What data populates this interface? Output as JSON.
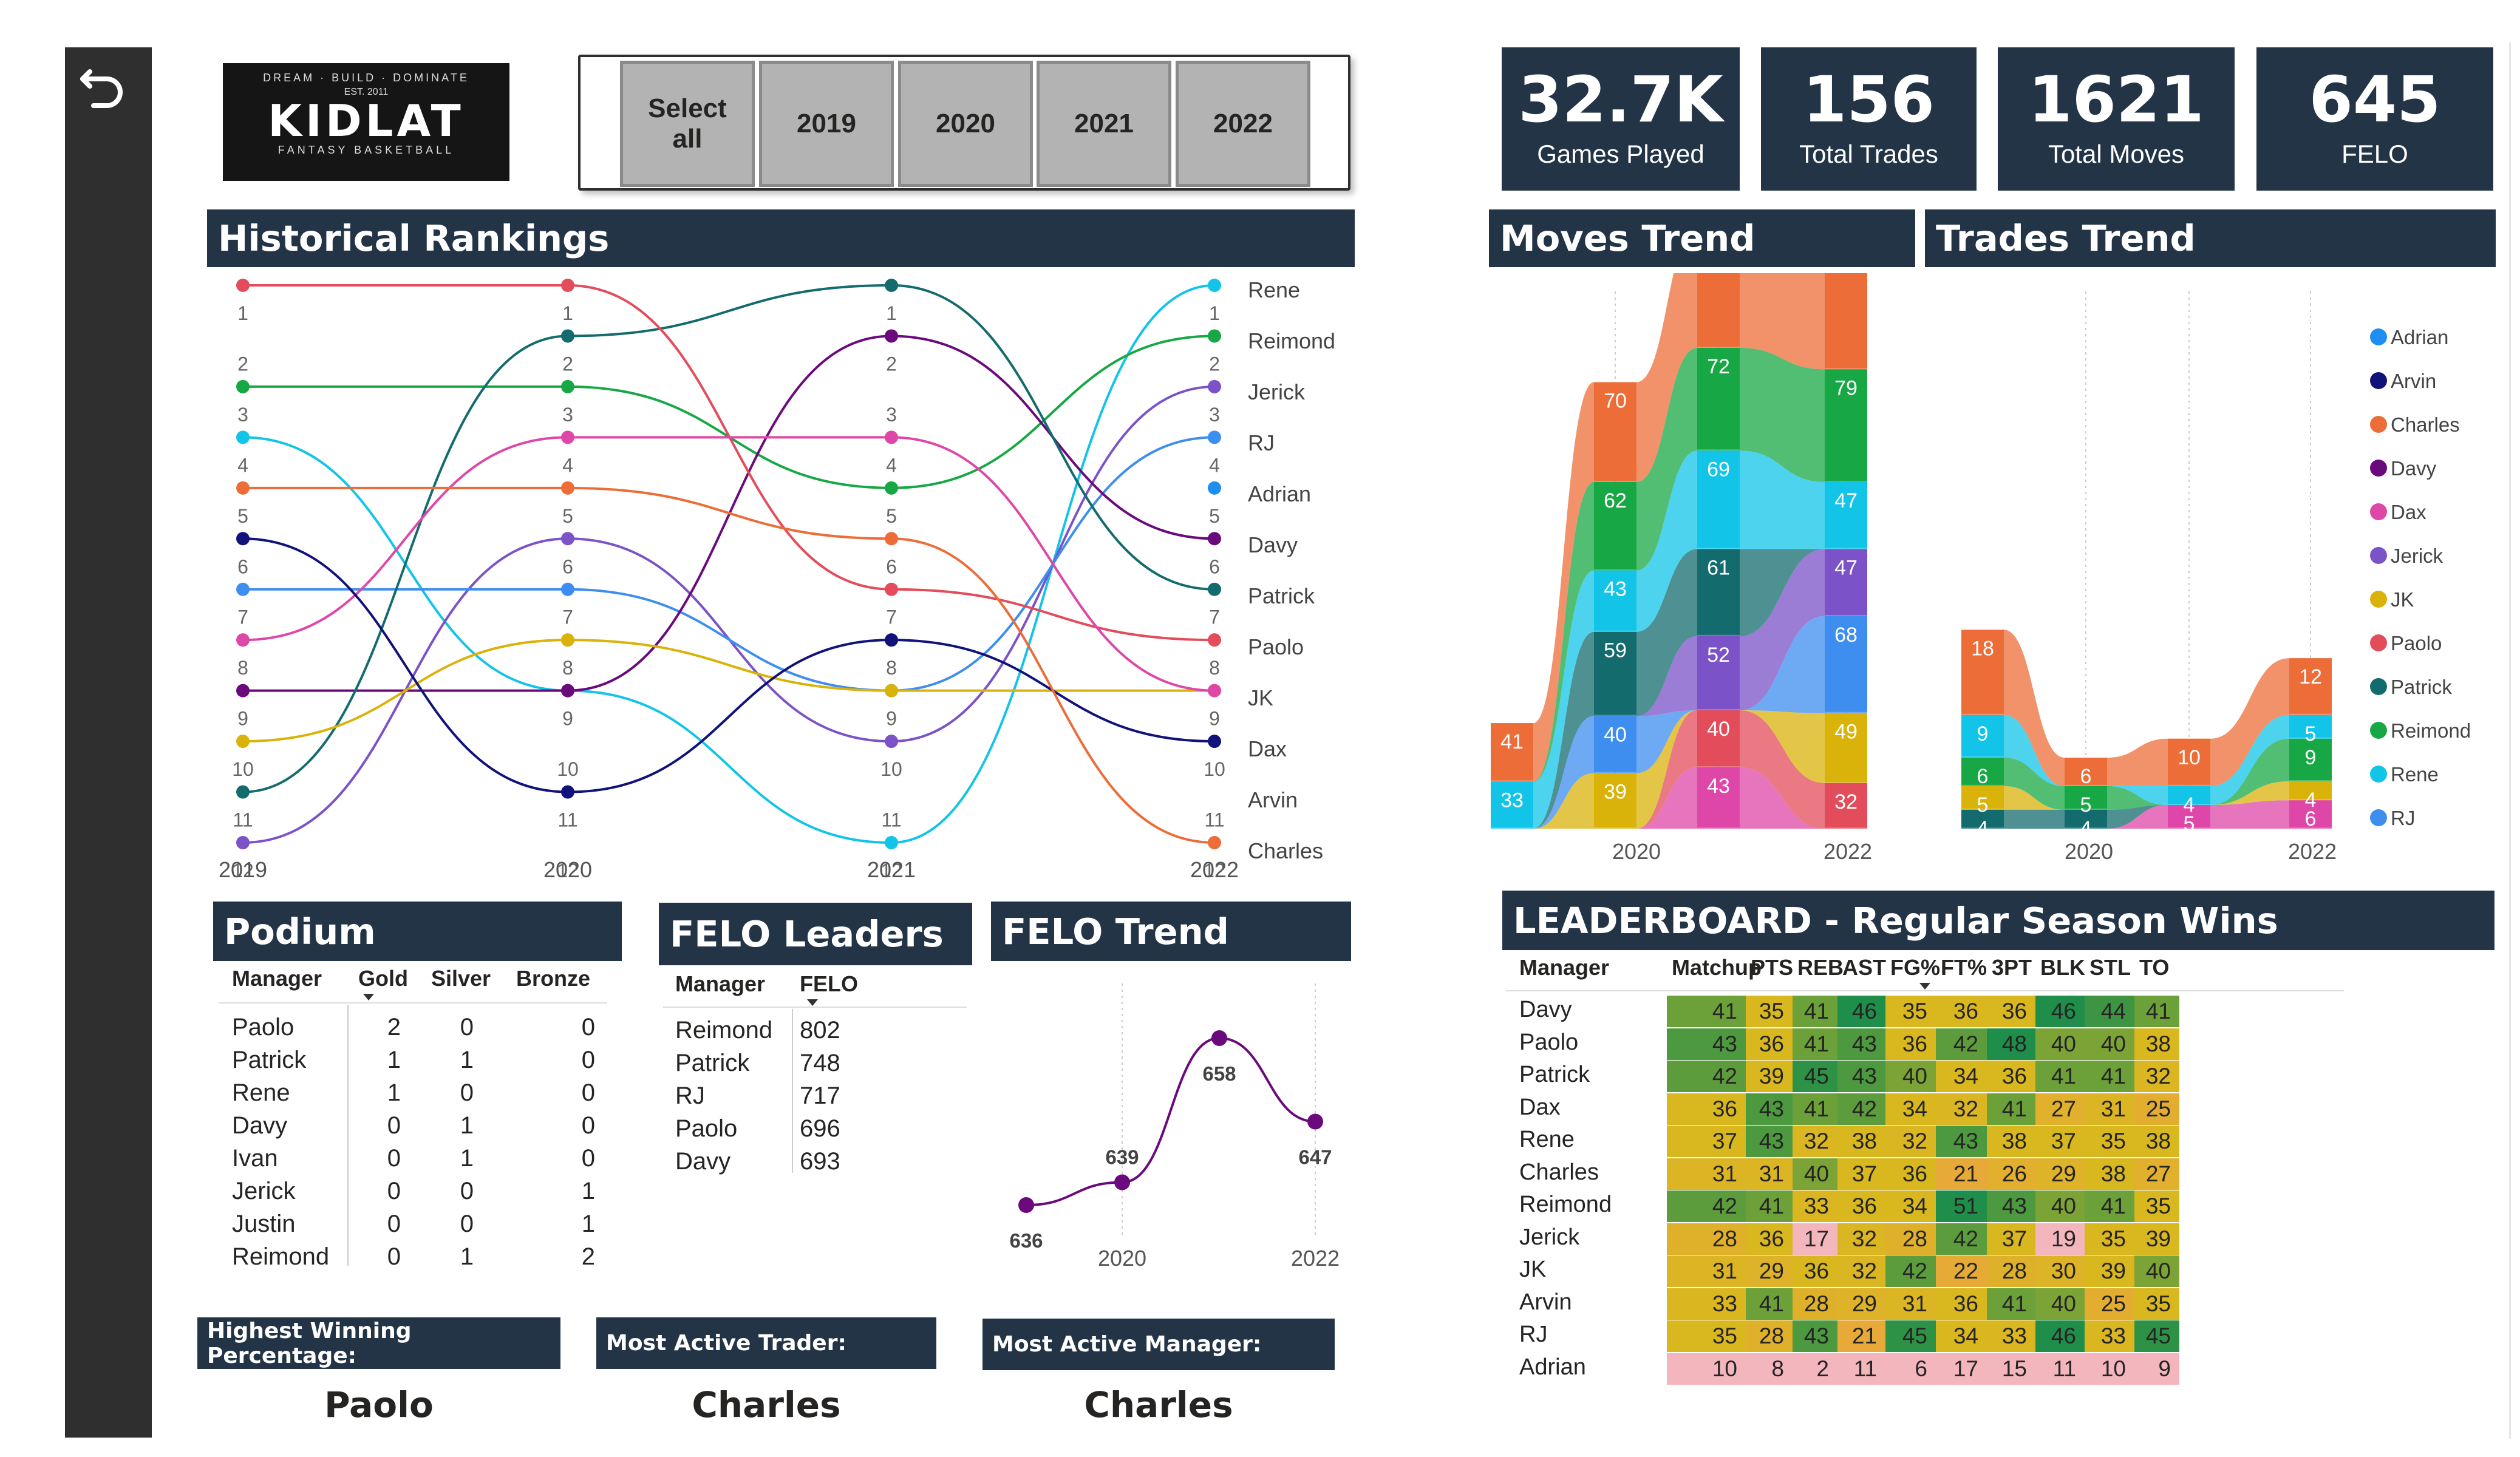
{
  "app": {
    "logo": {
      "brand": "KIDLAT",
      "tagline_top": "DREAM · BUILD · DOMINATE",
      "est": "EST. 2011",
      "tagline_bottom": "FANTASY BASKETBALL"
    },
    "back_icon": "back-arrow-icon"
  },
  "slicer": {
    "options": [
      "Select all",
      "2019",
      "2020",
      "2021",
      "2022"
    ]
  },
  "kpis": [
    {
      "value": "32.7K",
      "label": "Games Played"
    },
    {
      "value": "156",
      "label": "Total Trades"
    },
    {
      "value": "1621",
      "label": "Total Moves"
    },
    {
      "value": "645",
      "label": "FELO"
    }
  ],
  "titles": {
    "historical": "Historical Rankings",
    "moves": "Moves Trend",
    "trades": "Trades Trend",
    "podium": "Podium",
    "felo_leaders": "FELO Leaders",
    "felo_trend": "FELO Trend",
    "leaderboard": "LEADERBOARD - Regular Season Wins"
  },
  "chart_data": [
    {
      "type": "line",
      "name": "Historical Rankings",
      "x": [
        "2019",
        "2020",
        "2021",
        "2022"
      ],
      "y_reversed": true,
      "ylim": [
        1,
        12
      ],
      "series": [
        {
          "name": "Rene",
          "color": "#12c4e8",
          "values": [
            4,
            9,
            12,
            1
          ]
        },
        {
          "name": "Reimond",
          "color": "#17a845",
          "values": [
            3,
            3,
            5,
            2
          ]
        },
        {
          "name": "Jerick",
          "color": "#7b52c8",
          "values": [
            12,
            6,
            10,
            3
          ]
        },
        {
          "name": "RJ",
          "color": "#3e8ef0",
          "values": [
            7,
            7,
            9,
            4
          ]
        },
        {
          "name": "Adrian",
          "color": "#1f8ef2",
          "values": [
            null,
            null,
            null,
            5
          ]
        },
        {
          "name": "Davy",
          "color": "#6a0a7c",
          "values": [
            9,
            9,
            2,
            6
          ]
        },
        {
          "name": "Patrick",
          "color": "#146b6e",
          "values": [
            11,
            2,
            1,
            7
          ]
        },
        {
          "name": "Paolo",
          "color": "#e34c5a",
          "values": [
            1,
            1,
            7,
            8
          ]
        },
        {
          "name": "JK",
          "color": "#d9b30a",
          "values": [
            10,
            8,
            9,
            9
          ]
        },
        {
          "name": "Dax",
          "color": "#de47a8",
          "values": [
            8,
            4,
            4,
            9
          ]
        },
        {
          "name": "Arvin",
          "color": "#11127a",
          "values": [
            6,
            11,
            8,
            10
          ]
        },
        {
          "name": "Charles",
          "color": "#ec6d38",
          "values": [
            5,
            5,
            6,
            12
          ]
        }
      ],
      "row_labels": [
        "1",
        "1",
        "1",
        "1",
        "2",
        "2",
        "3",
        "3",
        "3",
        "4",
        "4",
        "4",
        "5",
        "5",
        "5",
        "6",
        "6",
        "6",
        "7",
        "7",
        "7",
        "8",
        "8",
        "8",
        "9",
        "9",
        "9",
        "10",
        "10",
        "10",
        "11",
        "11",
        "12",
        "12"
      ],
      "end_labels": [
        "Rene",
        "Reimond",
        "Jerick",
        "RJ",
        "Adrian",
        "Davy",
        "Patrick",
        "Paolo",
        "JK",
        "Dax",
        "Arvin",
        "Charles"
      ]
    },
    {
      "type": "area",
      "name": "Moves Trend",
      "x": [
        "2019",
        "2020",
        "2021",
        "2022"
      ],
      "series": [
        {
          "name": "Charles",
          "color": "#ec6d38",
          "values": [
            41,
            70,
            83,
            90
          ]
        },
        {
          "name": "Reimond",
          "color": "#17a845",
          "values": [
            null,
            62,
            72,
            79
          ]
        },
        {
          "name": "Rene",
          "color": "#12c4e8",
          "values": [
            33,
            43,
            69,
            47
          ]
        },
        {
          "name": "Patrick",
          "color": "#146b6e",
          "values": [
            null,
            59,
            61,
            null
          ]
        },
        {
          "name": "Jerick",
          "color": "#7b52c8",
          "values": [
            null,
            null,
            52,
            47
          ]
        },
        {
          "name": "RJ",
          "color": "#3e8ef0",
          "values": [
            null,
            40,
            null,
            68
          ]
        },
        {
          "name": "JK",
          "color": "#d9b30a",
          "values": [
            null,
            39,
            null,
            49
          ]
        },
        {
          "name": "Paolo",
          "color": "#e34c5a",
          "values": [
            null,
            null,
            40,
            32
          ]
        },
        {
          "name": "Dax",
          "color": "#de47a8",
          "values": [
            null,
            null,
            43,
            null
          ]
        }
      ],
      "xticks": [
        "2020",
        "2022"
      ]
    },
    {
      "type": "area",
      "name": "Trades Trend",
      "x": [
        "2019",
        "2020",
        "2021",
        "2022"
      ],
      "series": [
        {
          "name": "Charles",
          "color": "#ec6d38",
          "values": [
            18,
            6,
            10,
            12
          ]
        },
        {
          "name": "Rene",
          "color": "#12c4e8",
          "values": [
            9,
            null,
            4,
            5
          ]
        },
        {
          "name": "Reimond",
          "color": "#17a845",
          "values": [
            6,
            5,
            null,
            9
          ]
        },
        {
          "name": "JK",
          "color": "#d9b30a",
          "values": [
            5,
            null,
            null,
            4
          ]
        },
        {
          "name": "Patrick",
          "color": "#146b6e",
          "values": [
            4,
            4,
            null,
            null
          ]
        },
        {
          "name": "Dax",
          "color": "#de47a8",
          "values": [
            null,
            null,
            5,
            6
          ]
        }
      ],
      "xticks": [
        "2020",
        "2022"
      ],
      "legend": [
        "Adrian",
        "Arvin",
        "Charles",
        "Davy",
        "Dax",
        "Jerick",
        "JK",
        "Paolo",
        "Patrick",
        "Reimond",
        "Rene",
        "RJ"
      ],
      "legend_colors": [
        "#1f8ef2",
        "#11127a",
        "#ec6d38",
        "#6a0a7c",
        "#de47a8",
        "#7b52c8",
        "#d9b30a",
        "#e34c5a",
        "#146b6e",
        "#17a845",
        "#12c4e8",
        "#3e8ef0"
      ],
      "legend_position": "right"
    },
    {
      "type": "line",
      "name": "FELO Trend",
      "x": [
        "2019",
        "2020",
        "2021",
        "2022"
      ],
      "values": [
        636,
        639,
        658,
        647
      ],
      "xticks": [
        "2020",
        "2022"
      ],
      "color": "#6a0a7c"
    }
  ],
  "podium": {
    "columns": [
      "Manager",
      "Gold",
      "Silver",
      "Bronze"
    ],
    "rows": [
      [
        "Paolo",
        "2",
        "0",
        "0"
      ],
      [
        "Patrick",
        "1",
        "1",
        "0"
      ],
      [
        "Rene",
        "1",
        "0",
        "0"
      ],
      [
        "Davy",
        "0",
        "1",
        "0"
      ],
      [
        "Ivan",
        "0",
        "1",
        "0"
      ],
      [
        "Jerick",
        "0",
        "0",
        "1"
      ],
      [
        "Justin",
        "0",
        "0",
        "1"
      ],
      [
        "Reimond",
        "0",
        "1",
        "2"
      ]
    ]
  },
  "felo_leaders": {
    "columns": [
      "Manager",
      "FELO"
    ],
    "rows": [
      [
        "Reimond",
        "802"
      ],
      [
        "Patrick",
        "748"
      ],
      [
        "RJ",
        "717"
      ],
      [
        "Paolo",
        "696"
      ],
      [
        "Davy",
        "693"
      ]
    ]
  },
  "info_cards": [
    {
      "title": "Highest Winning Percentage:",
      "value": "Paolo"
    },
    {
      "title": "Most Active Trader:",
      "value": "Charles"
    },
    {
      "title": "Most Active Manager:",
      "value": "Charles"
    }
  ],
  "leaderboard": {
    "columns": [
      "Manager",
      "Matchup",
      "PTS",
      "REB",
      "AST",
      "FG%",
      "FT%",
      "3PT",
      "BLK",
      "STL",
      "TO"
    ],
    "rows": [
      [
        "Davy",
        41,
        35,
        41,
        46,
        35,
        36,
        36,
        46,
        44,
        41
      ],
      [
        "Paolo",
        43,
        36,
        41,
        43,
        36,
        42,
        48,
        40,
        40,
        38
      ],
      [
        "Patrick",
        42,
        39,
        45,
        43,
        40,
        34,
        36,
        41,
        41,
        32
      ],
      [
        "Dax",
        36,
        43,
        41,
        42,
        34,
        32,
        41,
        27,
        31,
        25
      ],
      [
        "Rene",
        37,
        43,
        32,
        38,
        32,
        43,
        38,
        37,
        35,
        38
      ],
      [
        "Charles",
        31,
        31,
        40,
        37,
        36,
        21,
        26,
        29,
        38,
        27
      ],
      [
        "Reimond",
        42,
        41,
        33,
        36,
        34,
        51,
        43,
        40,
        41,
        35
      ],
      [
        "Jerick",
        28,
        36,
        17,
        32,
        28,
        42,
        37,
        19,
        35,
        39
      ],
      [
        "JK",
        31,
        29,
        36,
        32,
        42,
        22,
        28,
        30,
        39,
        40
      ],
      [
        "Arvin",
        33,
        41,
        28,
        29,
        31,
        36,
        41,
        40,
        25,
        35
      ],
      [
        "RJ",
        35,
        28,
        43,
        21,
        45,
        34,
        33,
        46,
        33,
        45
      ],
      [
        "Adrian",
        10,
        8,
        2,
        11,
        6,
        17,
        15,
        11,
        10,
        9
      ]
    ],
    "scale_colors": {
      "high": "#1e8e4a",
      "mid": "#d9b81f",
      "low": "#f4b6bd"
    }
  }
}
